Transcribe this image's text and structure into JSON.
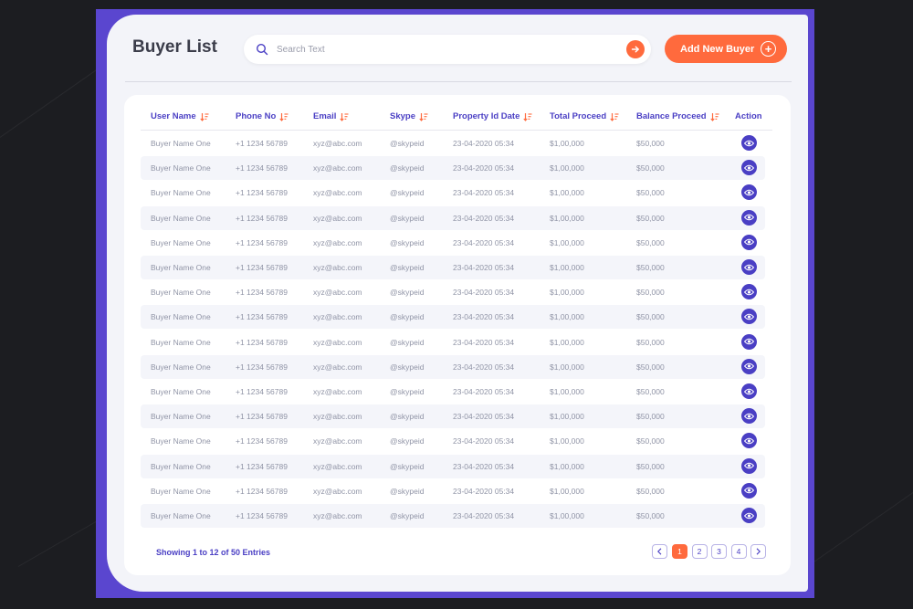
{
  "page": {
    "title": "Buyer List"
  },
  "search": {
    "placeholder": "Search Text",
    "value": ""
  },
  "actions": {
    "add_label": "Add New Buyer"
  },
  "table": {
    "columns": [
      "User Name",
      "Phone No",
      "Email",
      "Skype",
      "Property Id Date",
      "Total Proceed",
      "Balance Proceed",
      "Action"
    ],
    "rows": [
      [
        "Buyer Name One",
        "+1 1234 56789",
        "xyz@abc.com",
        "@skypeid",
        "23-04-2020 05:34",
        "$1,00,000",
        "$50,000"
      ],
      [
        "Buyer Name One",
        "+1 1234 56789",
        "xyz@abc.com",
        "@skypeid",
        "23-04-2020 05:34",
        "$1,00,000",
        "$50,000"
      ],
      [
        "Buyer Name One",
        "+1 1234 56789",
        "xyz@abc.com",
        "@skypeid",
        "23-04-2020 05:34",
        "$1,00,000",
        "$50,000"
      ],
      [
        "Buyer Name One",
        "+1 1234 56789",
        "xyz@abc.com",
        "@skypeid",
        "23-04-2020 05:34",
        "$1,00,000",
        "$50,000"
      ],
      [
        "Buyer Name One",
        "+1 1234 56789",
        "xyz@abc.com",
        "@skypeid",
        "23-04-2020 05:34",
        "$1,00,000",
        "$50,000"
      ],
      [
        "Buyer Name One",
        "+1 1234 56789",
        "xyz@abc.com",
        "@skypeid",
        "23-04-2020 05:34",
        "$1,00,000",
        "$50,000"
      ],
      [
        "Buyer Name One",
        "+1 1234 56789",
        "xyz@abc.com",
        "@skypeid",
        "23-04-2020 05:34",
        "$1,00,000",
        "$50,000"
      ],
      [
        "Buyer Name One",
        "+1 1234 56789",
        "xyz@abc.com",
        "@skypeid",
        "23-04-2020 05:34",
        "$1,00,000",
        "$50,000"
      ],
      [
        "Buyer Name One",
        "+1 1234 56789",
        "xyz@abc.com",
        "@skypeid",
        "23-04-2020 05:34",
        "$1,00,000",
        "$50,000"
      ],
      [
        "Buyer Name One",
        "+1 1234 56789",
        "xyz@abc.com",
        "@skypeid",
        "23-04-2020 05:34",
        "$1,00,000",
        "$50,000"
      ],
      [
        "Buyer Name One",
        "+1 1234 56789",
        "xyz@abc.com",
        "@skypeid",
        "23-04-2020 05:34",
        "$1,00,000",
        "$50,000"
      ],
      [
        "Buyer Name One",
        "+1 1234 56789",
        "xyz@abc.com",
        "@skypeid",
        "23-04-2020 05:34",
        "$1,00,000",
        "$50,000"
      ],
      [
        "Buyer Name One",
        "+1 1234 56789",
        "xyz@abc.com",
        "@skypeid",
        "23-04-2020 05:34",
        "$1,00,000",
        "$50,000"
      ],
      [
        "Buyer Name One",
        "+1 1234 56789",
        "xyz@abc.com",
        "@skypeid",
        "23-04-2020 05:34",
        "$1,00,000",
        "$50,000"
      ],
      [
        "Buyer Name One",
        "+1 1234 56789",
        "xyz@abc.com",
        "@skypeid",
        "23-04-2020 05:34",
        "$1,00,000",
        "$50,000"
      ],
      [
        "Buyer Name One",
        "+1 1234 56789",
        "xyz@abc.com",
        "@skypeid",
        "23-04-2020 05:34",
        "$1,00,000",
        "$50,000"
      ]
    ],
    "row_action_icon": "eye-icon",
    "sort_icon": "sort-desc-icon"
  },
  "footer": {
    "summary": "Showing 1 to 12 of 50 Entries",
    "pages": [
      "1",
      "2",
      "3",
      "4"
    ],
    "current_page": "1"
  },
  "colors": {
    "accent": "#ff6a3d",
    "primary": "#4a3fc4",
    "frame": "#5a46cf"
  }
}
